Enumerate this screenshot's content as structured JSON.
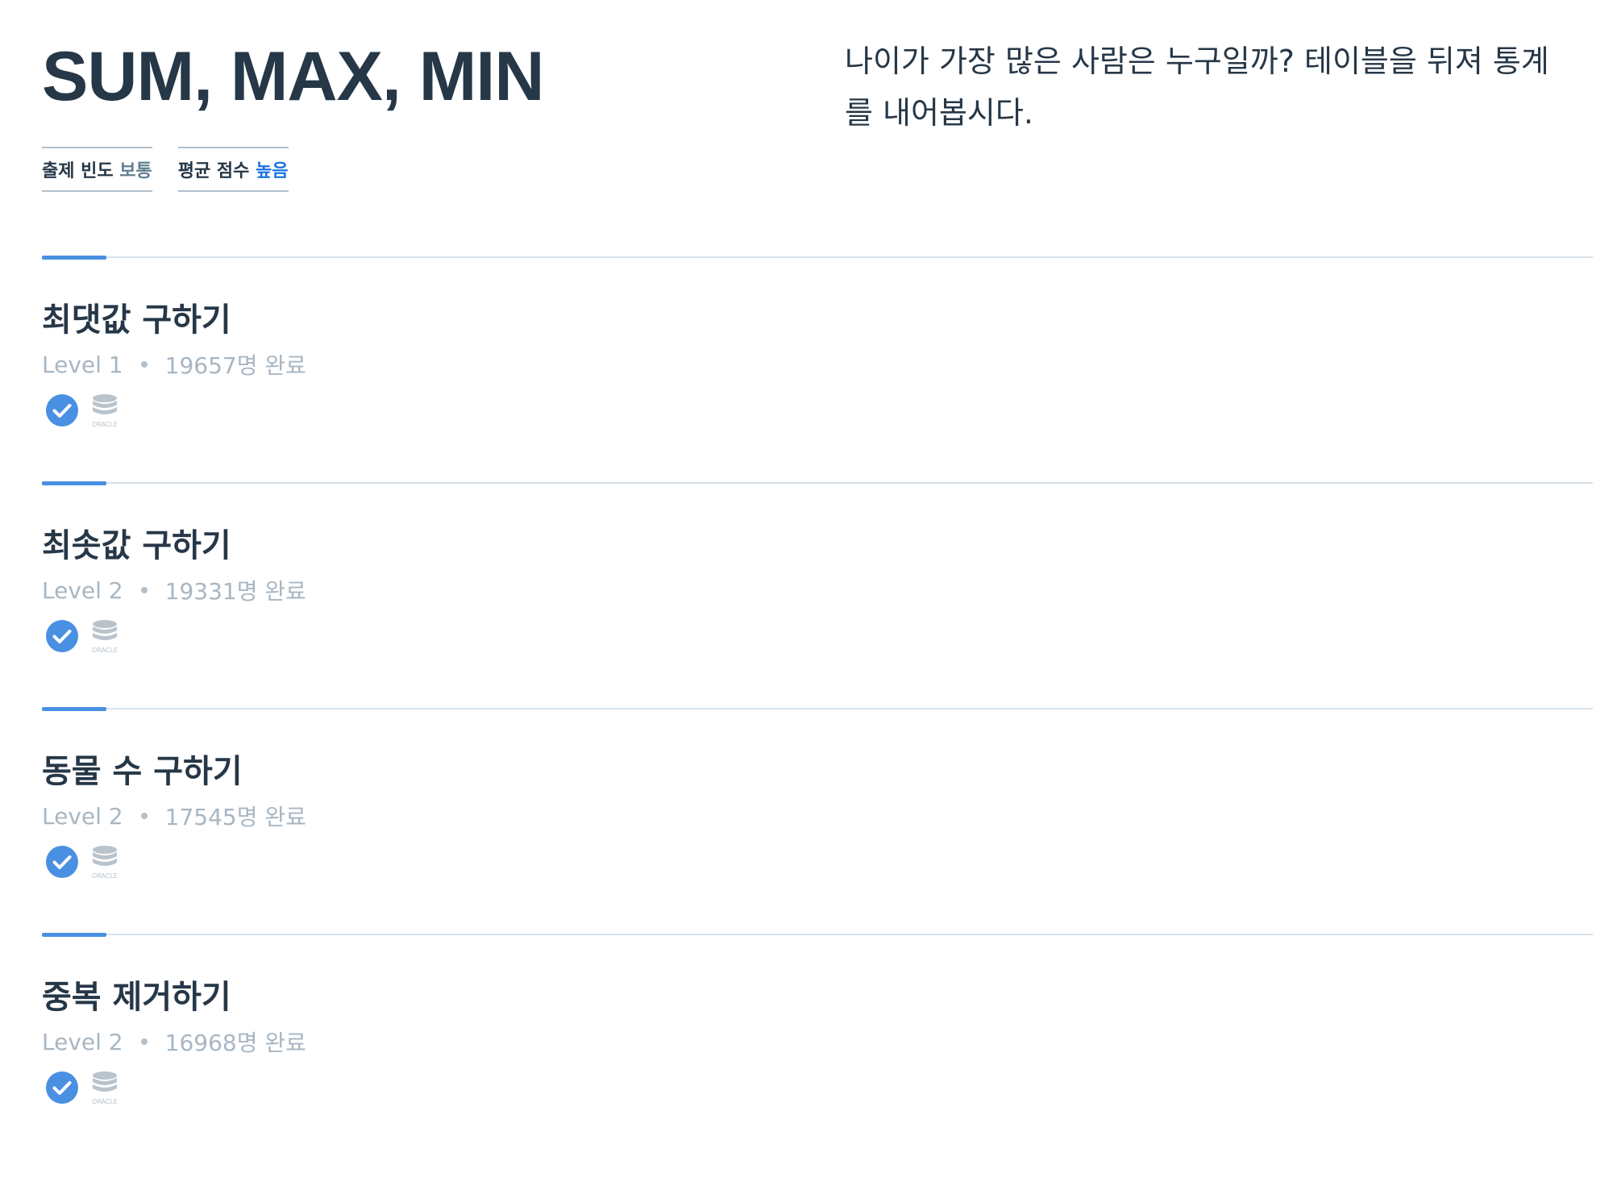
{
  "header": {
    "title": "SUM, MAX, MIN",
    "description": "나이가 가장 많은 사람은 누구일까? 테이블을 뒤져 통계를 내어봅시다.",
    "stats": [
      {
        "label": "출제 빈도",
        "value": "보통"
      },
      {
        "label": "평균 점수",
        "value": "높음"
      }
    ]
  },
  "problems": [
    {
      "title": "최댓값 구하기",
      "level": "Level 1",
      "completed": "19657명 완료"
    },
    {
      "title": "최솟값 구하기",
      "level": "Level 2",
      "completed": "19331명 완료"
    },
    {
      "title": "동물 수 구하기",
      "level": "Level 2",
      "completed": "17545명 완료"
    },
    {
      "title": "중복 제거하기",
      "level": "Level 2",
      "completed": "16968명 완료"
    }
  ],
  "icons": {
    "solved": "check-circle-icon",
    "database": "oracle-database-icon",
    "database_caption": "ORACLE"
  },
  "colors": {
    "text": "#263747",
    "muted": "#a8b6c2",
    "accent": "#4a90e2",
    "high": "#1c74e2",
    "normal": "#5f7f90"
  }
}
